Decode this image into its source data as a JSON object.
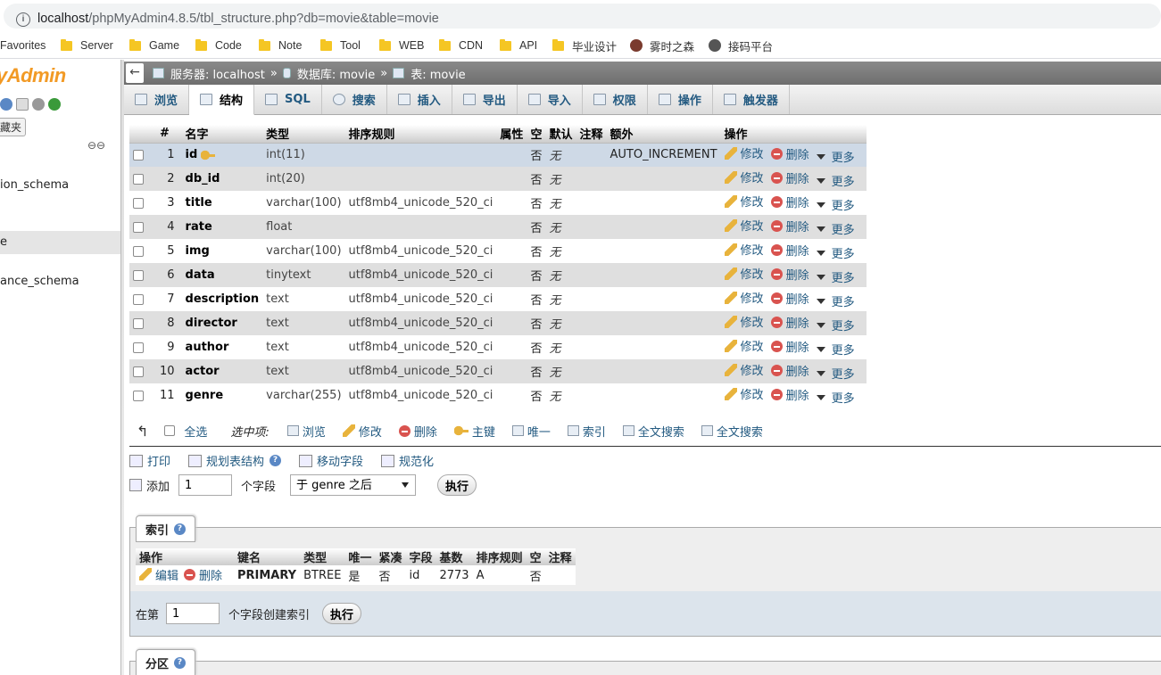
{
  "browser": {
    "url_host": "localhost",
    "url_path": "/phpMyAdmin4.8.5/tbl_structure.php?db=movie&table=movie",
    "bookmarks": [
      "Favorites",
      "Server",
      "Game",
      "Code",
      "Note",
      "Tool",
      "WEB",
      "CDN",
      "API",
      "毕业设计",
      "雾时之森",
      "接码平台"
    ]
  },
  "sidebar": {
    "logo": "yAdmin",
    "favorites_button": "藏夹",
    "items": [
      "ion_schema",
      "e",
      "ance_schema"
    ]
  },
  "breadcrumb": {
    "back": "←",
    "server": "服务器: localhost",
    "database": "数据库: movie",
    "table": "表: movie",
    "sep": "»"
  },
  "tabs": [
    "浏览",
    "结构",
    "SQL",
    "搜索",
    "插入",
    "导出",
    "导入",
    "权限",
    "操作",
    "触发器"
  ],
  "structure": {
    "headers": [
      "#",
      "名字",
      "类型",
      "排序规则",
      "属性",
      "空",
      "默认",
      "注释",
      "额外",
      "操作"
    ],
    "rows": [
      {
        "num": "1",
        "name": "id",
        "type": "int(11)",
        "collation": "",
        "attributes": "",
        "null": "否",
        "default": "无",
        "comment": "",
        "extra": "AUTO_INCREMENT",
        "key": true
      },
      {
        "num": "2",
        "name": "db_id",
        "type": "int(20)",
        "collation": "",
        "attributes": "",
        "null": "否",
        "default": "无",
        "comment": "",
        "extra": ""
      },
      {
        "num": "3",
        "name": "title",
        "type": "varchar(100)",
        "collation": "utf8mb4_unicode_520_ci",
        "attributes": "",
        "null": "否",
        "default": "无",
        "comment": "",
        "extra": ""
      },
      {
        "num": "4",
        "name": "rate",
        "type": "float",
        "collation": "",
        "attributes": "",
        "null": "否",
        "default": "无",
        "comment": "",
        "extra": ""
      },
      {
        "num": "5",
        "name": "img",
        "type": "varchar(100)",
        "collation": "utf8mb4_unicode_520_ci",
        "attributes": "",
        "null": "否",
        "default": "无",
        "comment": "",
        "extra": ""
      },
      {
        "num": "6",
        "name": "data",
        "type": "tinytext",
        "collation": "utf8mb4_unicode_520_ci",
        "attributes": "",
        "null": "否",
        "default": "无",
        "comment": "",
        "extra": ""
      },
      {
        "num": "7",
        "name": "description",
        "type": "text",
        "collation": "utf8mb4_unicode_520_ci",
        "attributes": "",
        "null": "否",
        "default": "无",
        "comment": "",
        "extra": ""
      },
      {
        "num": "8",
        "name": "director",
        "type": "text",
        "collation": "utf8mb4_unicode_520_ci",
        "attributes": "",
        "null": "否",
        "default": "无",
        "comment": "",
        "extra": ""
      },
      {
        "num": "9",
        "name": "author",
        "type": "text",
        "collation": "utf8mb4_unicode_520_ci",
        "attributes": "",
        "null": "否",
        "default": "无",
        "comment": "",
        "extra": ""
      },
      {
        "num": "10",
        "name": "actor",
        "type": "text",
        "collation": "utf8mb4_unicode_520_ci",
        "attributes": "",
        "null": "否",
        "default": "无",
        "comment": "",
        "extra": ""
      },
      {
        "num": "11",
        "name": "genre",
        "type": "varchar(255)",
        "collation": "utf8mb4_unicode_520_ci",
        "attributes": "",
        "null": "否",
        "default": "无",
        "comment": "",
        "extra": ""
      }
    ],
    "action_edit": "修改",
    "action_delete": "删除",
    "action_more": "更多"
  },
  "bulk": {
    "select_all": "全选",
    "with_selected": "选中项:",
    "actions": [
      "浏览",
      "修改",
      "删除",
      "主键",
      "唯一",
      "索引",
      "全文搜索",
      "全文搜索"
    ]
  },
  "tools": {
    "print": "打印",
    "propose": "规划表结构",
    "move": "移动字段",
    "normalize": "规范化"
  },
  "add": {
    "label": "添加",
    "count": "1",
    "unit": "个字段",
    "position": "于 genre 之后",
    "go": "执行"
  },
  "indexes": {
    "legend": "索引",
    "headers": [
      "操作",
      "键名",
      "类型",
      "唯一",
      "紧凑",
      "字段",
      "基数",
      "排序规则",
      "空",
      "注释"
    ],
    "row": {
      "edit": "编辑",
      "delete": "删除",
      "key_name": "PRIMARY",
      "type": "BTREE",
      "unique": "是",
      "packed": "否",
      "column": "id",
      "cardinality": "2773",
      "collation": "A",
      "null": "否",
      "comment": ""
    },
    "create_prefix": "在第",
    "create_count": "1",
    "create_suffix": "个字段创建索引",
    "go": "执行"
  },
  "partitions": {
    "legend": "分区"
  }
}
